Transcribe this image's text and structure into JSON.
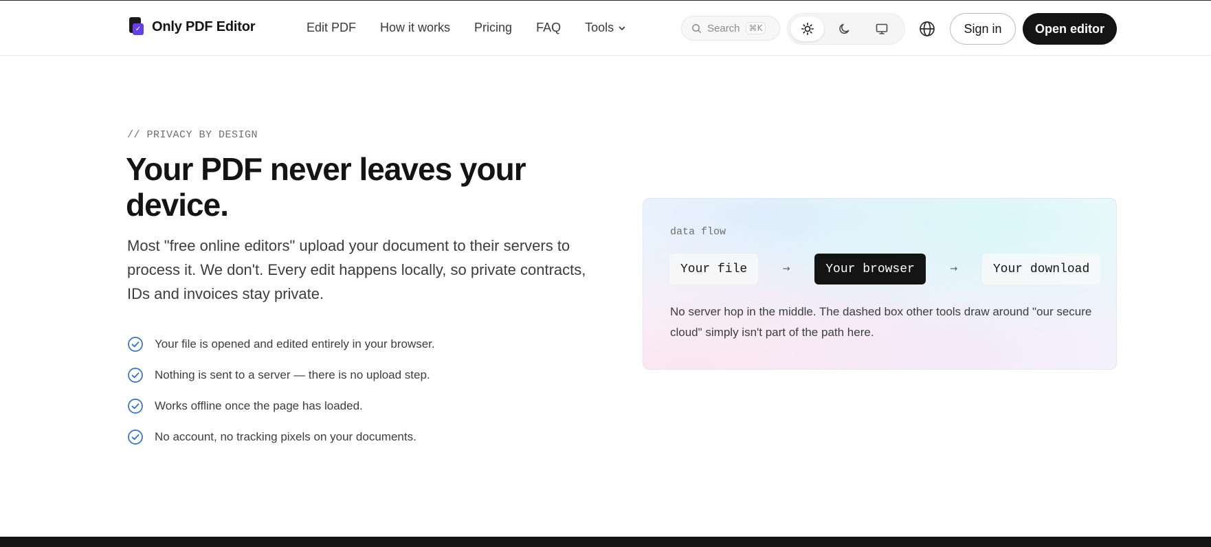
{
  "header": {
    "logo_text": "Only PDF Editor",
    "nav": [
      "Edit PDF",
      "How it works",
      "Pricing",
      "FAQ",
      "Tools"
    ],
    "search": {
      "placeholder": "Search",
      "shortcut": "⌘K"
    },
    "theme_options": [
      "light-icon",
      "moon-icon",
      "monitor-icon"
    ],
    "sign_in": "Sign in",
    "open_editor": "Open editor"
  },
  "hero": {
    "eyebrow": "// PRIVACY BY DESIGN",
    "title": "Your PDF never leaves your device.",
    "lede": "Most \"free online editors\" upload your document to their servers to process it. We don't. Every edit happens locally, so private contracts, IDs and invoices stay private.",
    "checks": [
      "Your file is opened and edited entirely in your browser.",
      "Nothing is sent to a server — there is no upload step.",
      "Works offline once the page has loaded.",
      "No account, no tracking pixels on your documents."
    ]
  },
  "card": {
    "label": "data flow",
    "nodes": [
      "Your file",
      "Your browser",
      "Your download"
    ],
    "arrow": "→",
    "note": "No server hop in the middle. The dashed box other tools draw around \"our secure cloud\" simply isn't part of the path here."
  },
  "colors": {
    "primary": "#141414",
    "check_blue": "#2f6fd0",
    "text_muted": "#3d3d3d"
  }
}
